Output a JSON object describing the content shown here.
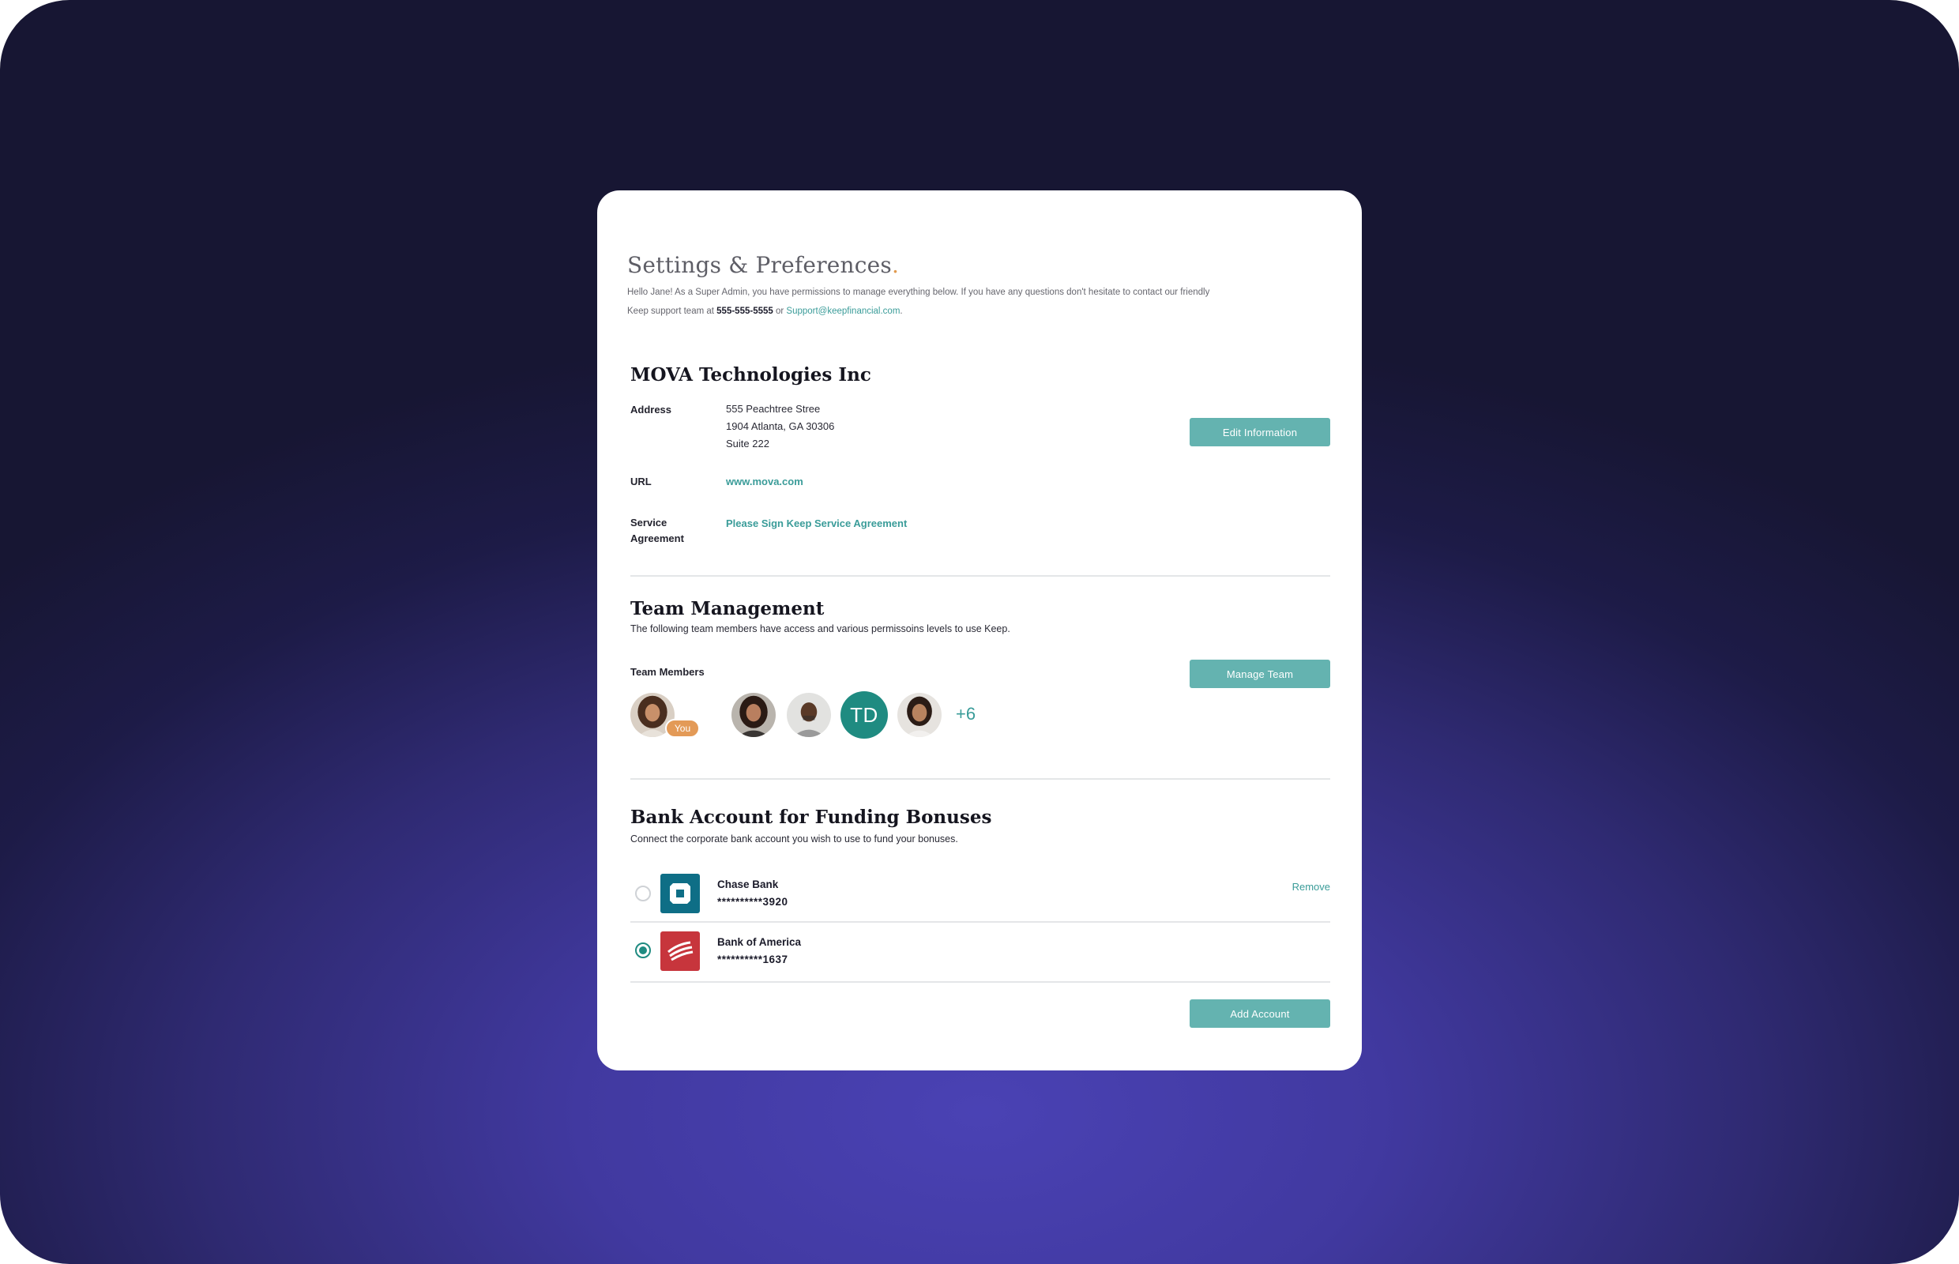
{
  "header": {
    "title": "Settings & Preferences",
    "title_dot": ".",
    "intro_1": "Hello Jane! As a Super Admin, you have permissions to manage everything below. If you have any questions don't hesitate to contact our friendly",
    "intro_2a": "Keep support team at ",
    "phone": "555-555-5555",
    "intro_2b": " or ",
    "email": "Support@keepfinancial.com",
    "intro_2c": "."
  },
  "company": {
    "name": "MOVA Technologies Inc",
    "address_label": "Address",
    "address_lines": [
      "555 Peachtree Stree",
      "1904 Atlanta, GA 30306",
      "Suite 222"
    ],
    "url_label": "URL",
    "url": "www.mova.com",
    "agreement_label_1": "Service",
    "agreement_label_2": "Agreement",
    "agreement_link": "Please Sign Keep Service Agreement",
    "edit_button": "Edit Information"
  },
  "team": {
    "title": "Team Management",
    "subtitle": "The following team members have access and various permissoins levels to use Keep.",
    "members_label": "Team Members",
    "manage_button": "Manage Team",
    "you_badge": "You",
    "initials": "TD",
    "more_count": "+6"
  },
  "bank": {
    "title": "Bank Account for Funding Bonuses",
    "subtitle": "Connect the corporate bank account you wish to use to fund your bonuses.",
    "accounts": [
      {
        "name": "Chase Bank",
        "number": "**********3920",
        "selected": false
      },
      {
        "name": "Bank of America",
        "number": "**********1637",
        "selected": true
      }
    ],
    "remove_label": "Remove",
    "add_button": "Add Account"
  },
  "colors": {
    "accent": "#64b3b0",
    "link": "#3a9c99",
    "teal_dark": "#1f8b81",
    "badge": "#e39a57",
    "chase": "#0e6e86",
    "boa": "#c7353c"
  }
}
